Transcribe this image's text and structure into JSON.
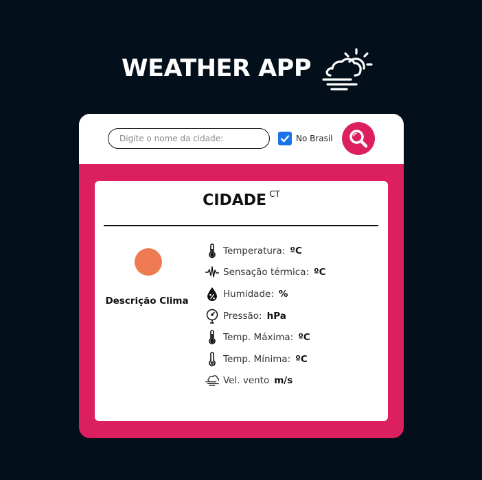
{
  "header": {
    "title": "WEATHER APP",
    "icon": "cloud-sun-wind-icon"
  },
  "search": {
    "placeholder": "Digite o nome da cidade:",
    "value": "",
    "checkbox_label": "No Brasil",
    "checkbox_checked": true,
    "button_icon": "search-icon"
  },
  "colors": {
    "background": "#03101c",
    "accent": "#dc1f5e",
    "checkbox": "#1a73e8",
    "weather_icon": "#ee7a52"
  },
  "result": {
    "city": "CIDADE",
    "country": "CT",
    "description": "Descrição Clima",
    "details": [
      {
        "icon": "thermometer-icon",
        "label": "Temperatura:",
        "unit": "ºC"
      },
      {
        "icon": "pulse-icon",
        "label": "Sensação térmica:",
        "unit": "ºC"
      },
      {
        "icon": "humidity-drop-icon",
        "label": "Humidade:",
        "unit": "%"
      },
      {
        "icon": "pressure-gauge-icon",
        "label": "Pressão:",
        "unit": "hPa"
      },
      {
        "icon": "thermometer-icon",
        "label": "Temp. Máxima:",
        "unit": "ºC"
      },
      {
        "icon": "thermometer-icon",
        "label": "Temp. Mínima:",
        "unit": "ºC"
      },
      {
        "icon": "wind-cloud-icon",
        "label": "Vel. vento",
        "unit": "m/s"
      }
    ]
  }
}
